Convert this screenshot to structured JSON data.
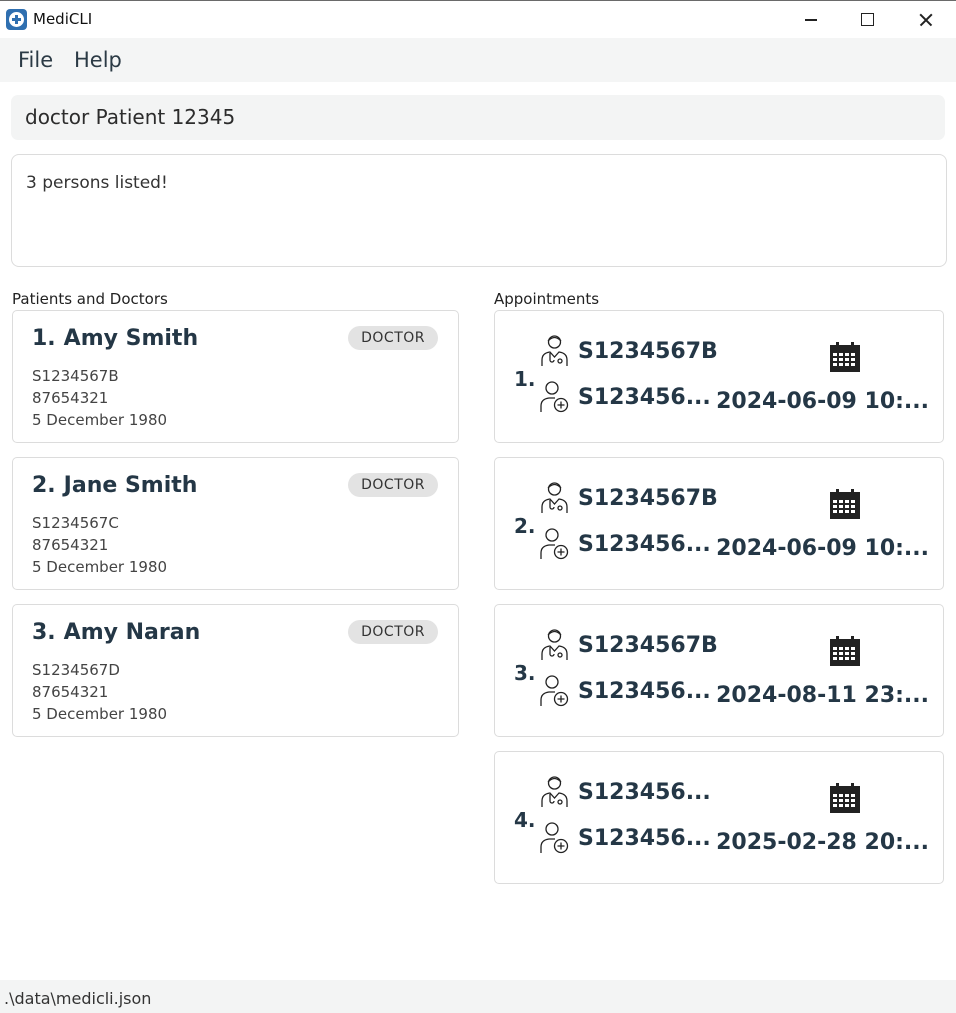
{
  "window": {
    "title": "MediCLI"
  },
  "menu": {
    "file": "File",
    "help": "Help"
  },
  "command": {
    "value": "doctor Patient 12345"
  },
  "result": {
    "message": "3 persons listed!"
  },
  "sections": {
    "persons": "Patients and Doctors",
    "appointments": "Appointments"
  },
  "persons": [
    {
      "index": "1.",
      "name": "Amy Smith",
      "tag": "DOCTOR",
      "nric": "S1234567B",
      "phone": "87654321",
      "dob": "5 December 1980"
    },
    {
      "index": "2.",
      "name": "Jane Smith",
      "tag": "DOCTOR",
      "nric": "S1234567C",
      "phone": "87654321",
      "dob": "5 December 1980"
    },
    {
      "index": "3.",
      "name": "Amy Naran",
      "tag": "DOCTOR",
      "nric": "S1234567D",
      "phone": "87654321",
      "dob": "5 December 1980"
    }
  ],
  "appointments": [
    {
      "index": "1.",
      "doctor_nric": "S1234567B",
      "patient_nric": "S123456...",
      "datetime": "2024-06-09 10:..."
    },
    {
      "index": "2.",
      "doctor_nric": "S1234567B",
      "patient_nric": "S123456...",
      "datetime": "2024-06-09 10:..."
    },
    {
      "index": "3.",
      "doctor_nric": "S1234567B",
      "patient_nric": "S123456...",
      "datetime": "2024-08-11 23:..."
    },
    {
      "index": "4.",
      "doctor_nric": "S123456...",
      "patient_nric": "S123456...",
      "datetime": "2025-02-28 20:..."
    }
  ],
  "status": {
    "path": ".\\data\\medicli.json"
  },
  "icons": {
    "app": "medical-cross-icon",
    "doctor": "doctor-icon",
    "patient": "patient-icon",
    "date": "calendar-icon"
  }
}
